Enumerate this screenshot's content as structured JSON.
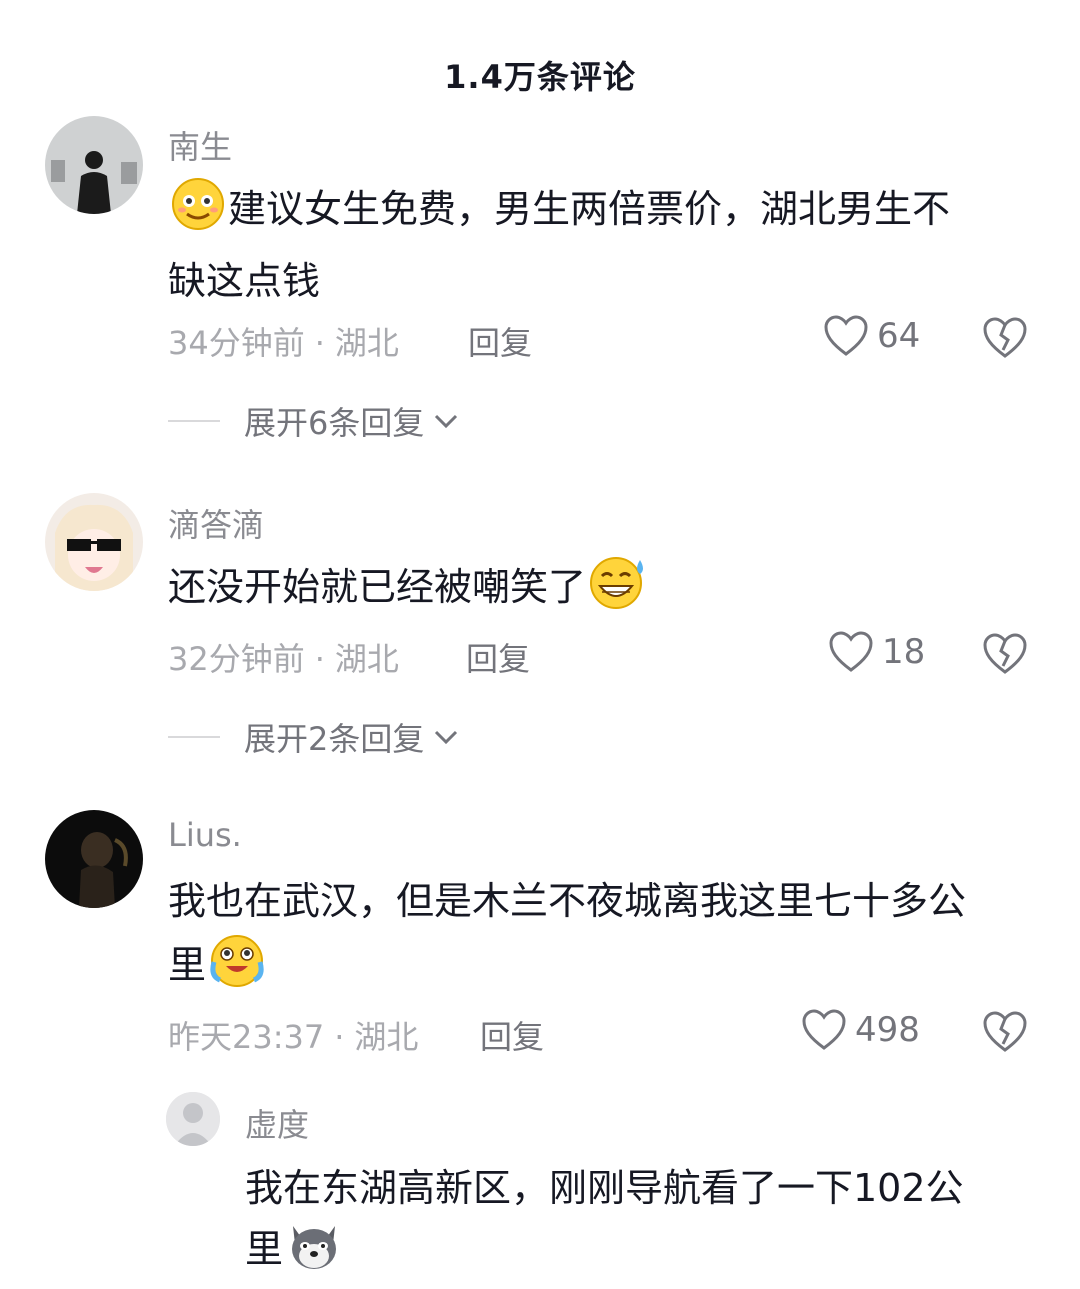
{
  "header": {
    "title": "1.4万条评论"
  },
  "comments": [
    {
      "name": "南生",
      "text_line1": "建议女生免费，男生两倍票价，湖北男生不",
      "text_line2": "缺这点钱",
      "emoji": "smile-emoji",
      "time": "34分钟前",
      "location": "湖北",
      "reply_label": "回复",
      "likes": "64",
      "expand_label": "展开6条回复"
    },
    {
      "name": "滴答滴",
      "text_line1": "还没开始就已经被嘲笑了",
      "emoji": "sweat-grin-emoji",
      "time": "32分钟前",
      "location": "湖北",
      "reply_label": "回复",
      "likes": "18",
      "expand_label": "展开2条回复"
    },
    {
      "name": "Lius.",
      "text_line1": "我也在武汉，但是木兰不夜城离我这里七十多公",
      "text_line2": "里",
      "emoji": "crying-laugh-emoji",
      "time": "昨天23:37",
      "location": "湖北",
      "reply_label": "回复",
      "likes": "498"
    }
  ],
  "sub_comment": {
    "name": "虚度",
    "text_line1": "我在东湖高新区，刚刚导航看了一下102公",
    "text_line2": "里",
    "emoji": "husky-emoji"
  },
  "colors": {
    "text_primary": "#161823",
    "text_secondary": "#8a8b91",
    "text_meta": "#a8a9ae",
    "icon": "#73747b"
  }
}
